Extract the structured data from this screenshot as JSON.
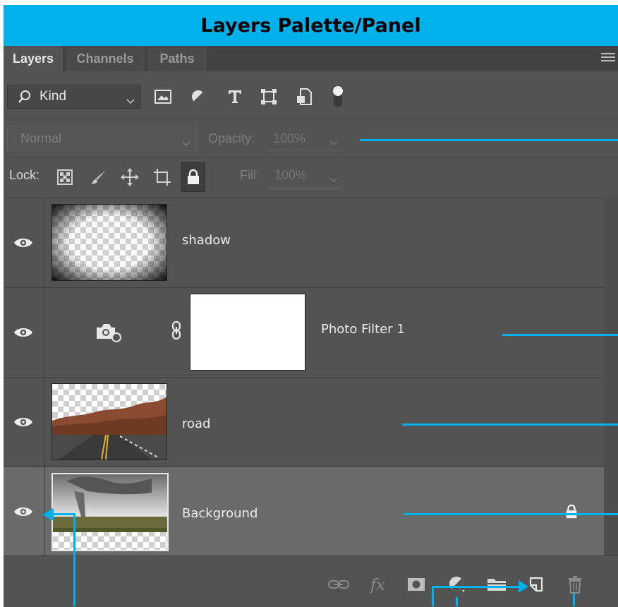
{
  "title": "Layers Palette/Panel",
  "tabs": [
    {
      "label": "Layers",
      "active": true
    },
    {
      "label": "Channels",
      "active": false
    },
    {
      "label": "Paths",
      "active": false
    }
  ],
  "filter": {
    "kind_label": "Kind",
    "icons": [
      "image-filter-icon",
      "adjustment-filter-icon",
      "type-filter-icon",
      "shape-filter-icon",
      "smart-object-filter-icon",
      "filter-toggle-icon"
    ]
  },
  "blend": {
    "mode": "Normal",
    "opacity_label": "Opacity:",
    "opacity_value": "100%"
  },
  "lock": {
    "label": "Lock:",
    "fill_label": "Fill:",
    "fill_value": "100%",
    "icons": [
      "lock-transparent-pixels-icon",
      "lock-image-pixels-icon",
      "lock-position-icon",
      "lock-artboard-icon",
      "lock-all-icon"
    ]
  },
  "layers": [
    {
      "name": "shadow",
      "visible": true,
      "selected": false
    },
    {
      "name": "Photo Filter 1",
      "visible": true,
      "selected": false
    },
    {
      "name": "road",
      "visible": true,
      "selected": false
    },
    {
      "name": "Background",
      "visible": true,
      "selected": true,
      "locked": true
    }
  ],
  "bottom_icons": [
    "link-layers-icon",
    "fx-icon",
    "layer-mask-icon",
    "adjustment-layer-icon",
    "group-folder-icon",
    "new-layer-icon",
    "trash-icon"
  ],
  "colors": {
    "accent": "#00b2ec",
    "panel": "#535353",
    "selected_row": "#6a6a6a"
  }
}
